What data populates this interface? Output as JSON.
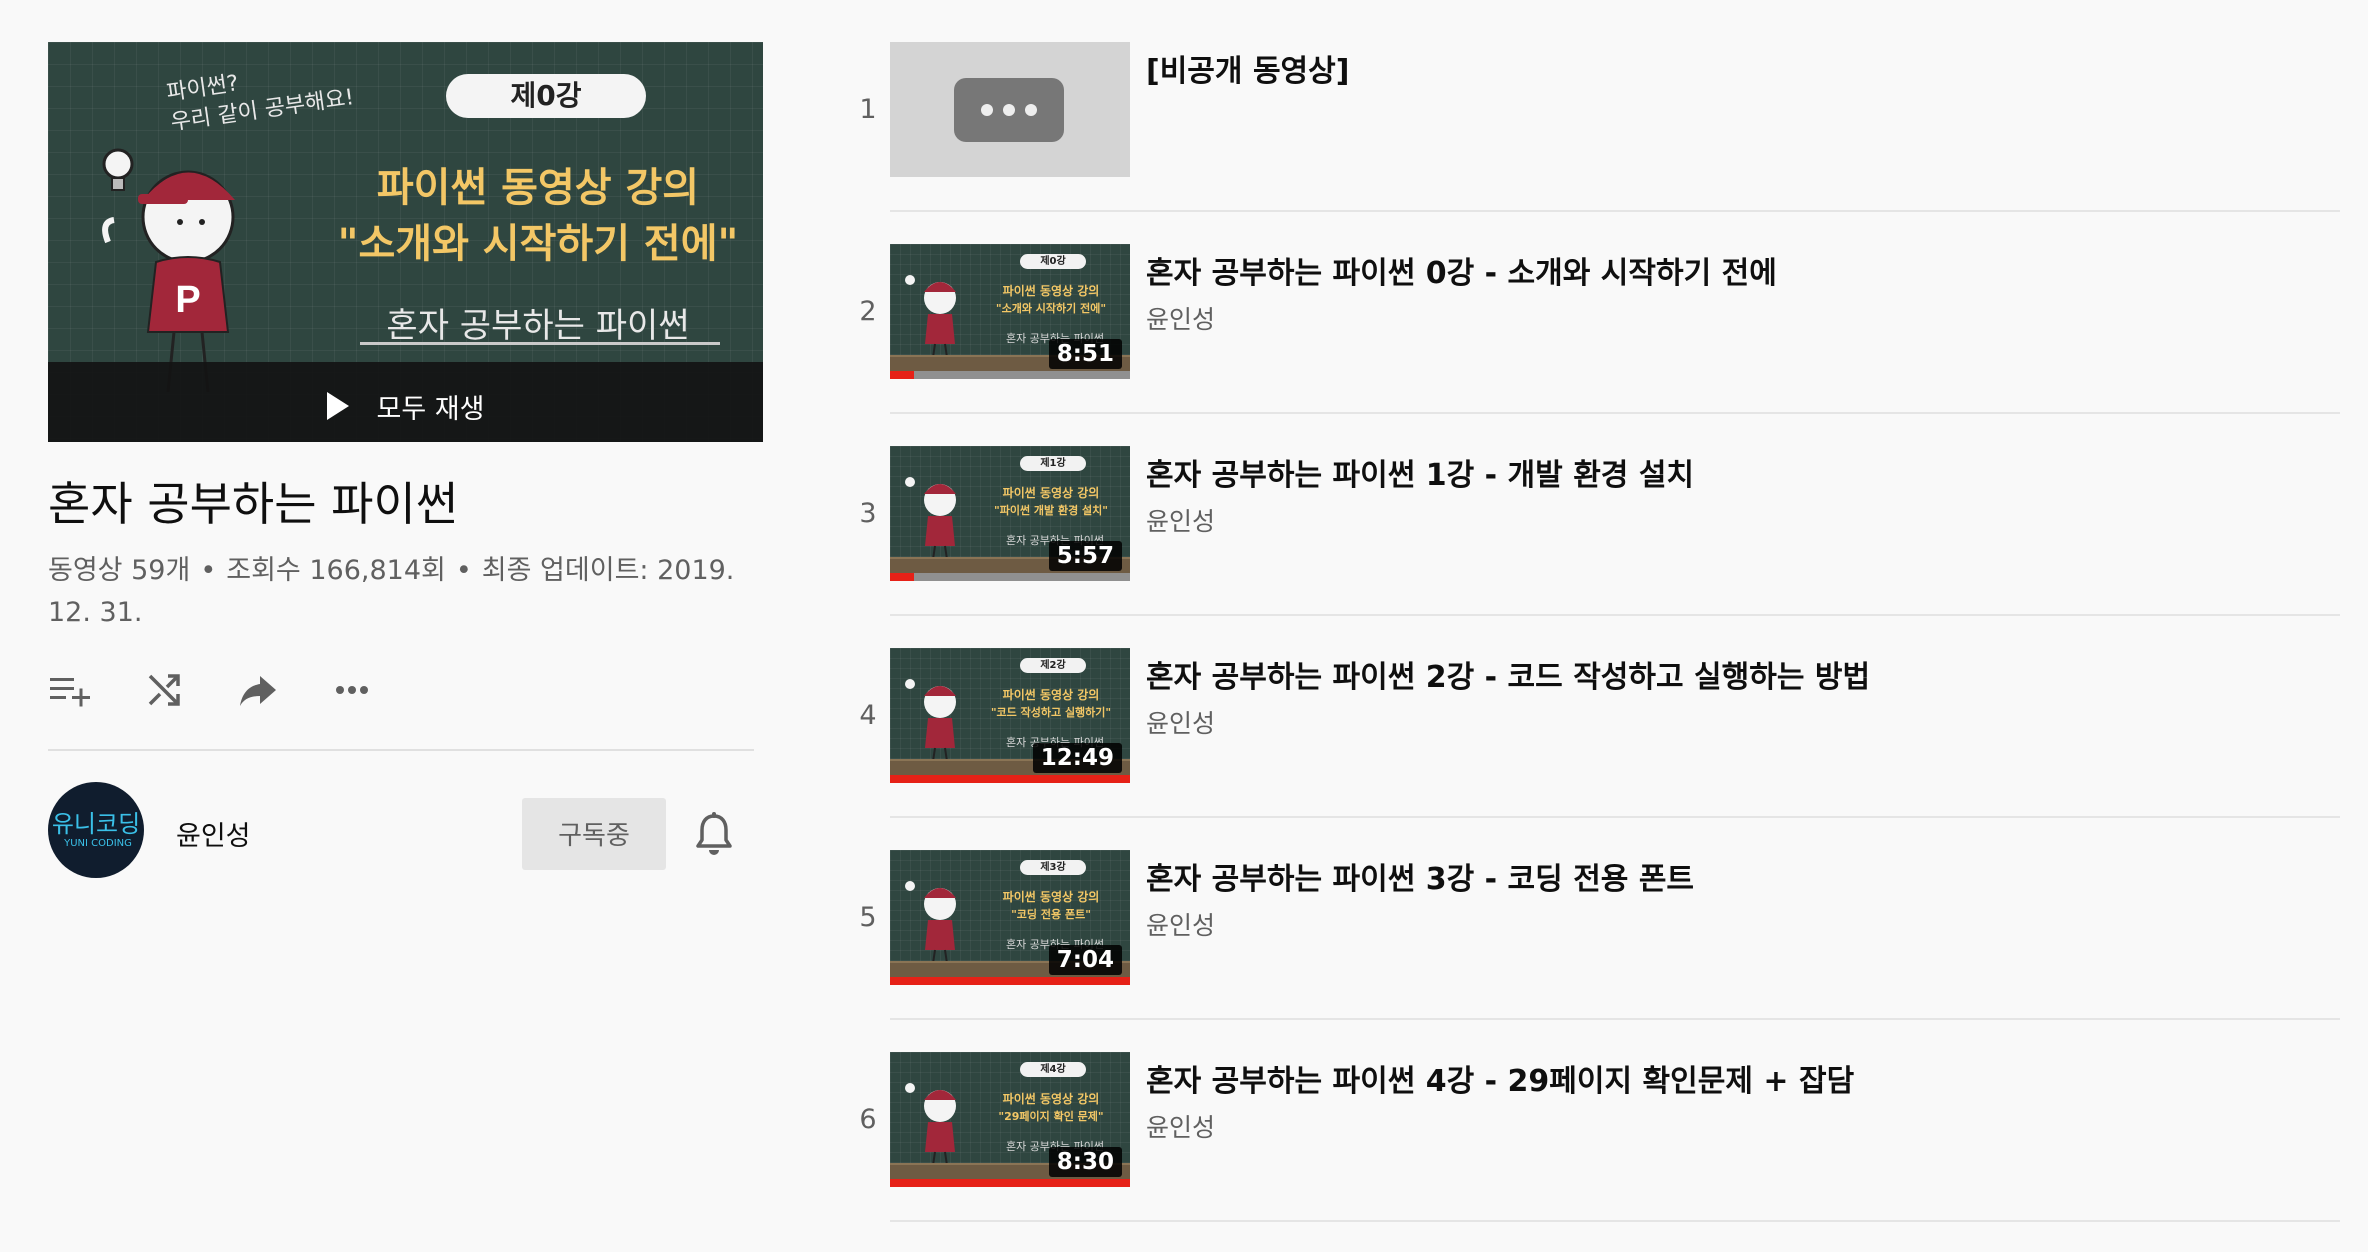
{
  "playlist": {
    "thumbnail": {
      "scribble": [
        "파이썬?",
        "우리 같이 공부해요!"
      ],
      "badge": "제0강",
      "title_line1": "파이썬 동영상 강의",
      "title_line2": "\"소개와 시작하기 전에\"",
      "subtitle": "혼자 공부하는 파이썬",
      "shirt_letter": "P"
    },
    "play_all_label": "모두 재생",
    "title": "혼자 공부하는 파이썬",
    "stats": {
      "videos": "동영상 59개",
      "views": "조회수 166,814회",
      "updated": "최종 업데이트: 2019. 12. 31."
    },
    "actions": [
      "add-to-queue-icon",
      "shuffle-icon",
      "share-icon",
      "more-icon"
    ],
    "owner": {
      "avatar_text_top": "유니코딩",
      "avatar_text_bottom": "YUNI CODING",
      "name": "윤인성",
      "subscribe_label": "구독중"
    }
  },
  "videos": [
    {
      "index": "1",
      "title": "[비공개 동영상]",
      "private": true
    },
    {
      "index": "2",
      "title": "혼자 공부하는 파이썬 0강 - 소개와 시작하기 전에",
      "channel": "윤인성",
      "duration": "8:51",
      "thumb": {
        "badge": "제0강",
        "line1": "파이썬 동영상 강의",
        "line2": "\"소개와 시작하기 전에\"",
        "line3": "혼자 공부하는 파이썬"
      },
      "watched": 0.1
    },
    {
      "index": "3",
      "title": "혼자 공부하는 파이썬 1강 - 개발 환경 설치",
      "channel": "윤인성",
      "duration": "5:57",
      "thumb": {
        "badge": "제1강",
        "line1": "파이썬 동영상 강의",
        "line2": "\"파이썬 개발 환경 설치\"",
        "line3": "혼자 공부하는 파이썬"
      },
      "watched": 0.1
    },
    {
      "index": "4",
      "title": "혼자 공부하는 파이썬 2강 - 코드 작성하고 실행하는 방법",
      "channel": "윤인성",
      "duration": "12:49",
      "thumb": {
        "badge": "제2강",
        "line1": "파이썬 동영상 강의",
        "line2": "\"코드 작성하고 실행하기\"",
        "line3": "혼자 공부하는 파이썬"
      },
      "watched": 1.0
    },
    {
      "index": "5",
      "title": "혼자 공부하는 파이썬 3강 - 코딩 전용 폰트",
      "channel": "윤인성",
      "duration": "7:04",
      "thumb": {
        "badge": "제3강",
        "line1": "파이썬 동영상 강의",
        "line2": "\"코딩 전용 폰트\"",
        "line3": "혼자 공부하는 파이썬"
      },
      "watched": 1.0
    },
    {
      "index": "6",
      "title": "혼자 공부하는 파이썬 4강 - 29페이지 확인문제 + 잡담",
      "channel": "윤인성",
      "duration": "8:30",
      "thumb": {
        "badge": "제4강",
        "line1": "파이썬 동영상 강의",
        "line2": "\"29페이지 확인 문제\"",
        "line3": "혼자 공부하는 파이썬"
      },
      "watched": 1.0
    }
  ],
  "colors": {
    "accent": "#e62117",
    "chalkboard": "#2f4640",
    "chalk_yellow": "#f3c766",
    "avatar_bg": "#101d2e",
    "avatar_text": "#3ac0e8"
  }
}
